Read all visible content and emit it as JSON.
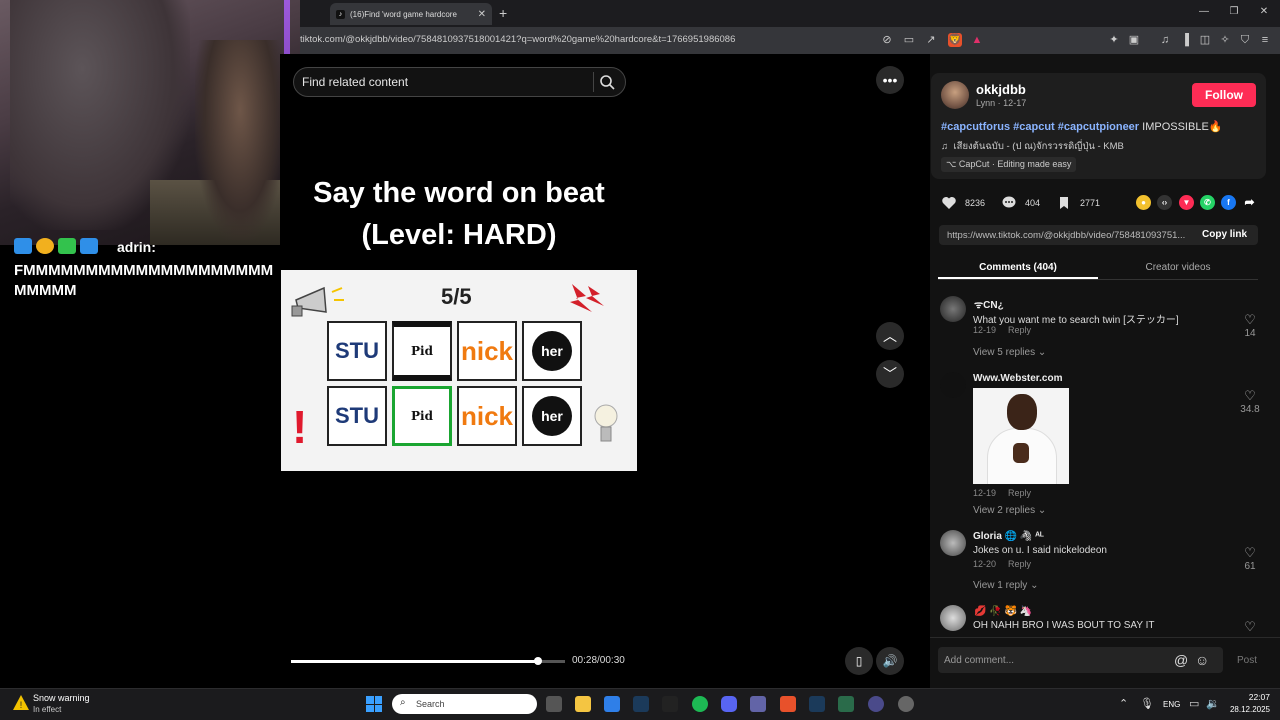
{
  "browser": {
    "tab_title": "(16)Find 'word game hardcore",
    "url": "tiktok.com/@okkjdbb/video/7584810937518001421?q=word%20game%20hardcore&t=1766951986086"
  },
  "chat": {
    "username": "adrin:",
    "message": "FMMMMMMMMMMMMMMMMMMMMMMMMM"
  },
  "video": {
    "search_placeholder": "Find related content",
    "headline_line1": "Say the word on beat",
    "headline_line2": "(Level: HARD)",
    "score": "5/5",
    "row1": [
      "STU",
      "Pid",
      "nick",
      "her"
    ],
    "row2": [
      "STU",
      "Pid",
      "nick",
      "her"
    ],
    "time": "00:28/00:30",
    "progress": 0.9
  },
  "post": {
    "username": "okkjdbb",
    "subline": "Lynn · 12-17",
    "follow_label": "Follow",
    "hashtags": [
      "#capcutforus",
      "#capcut",
      "#capcutpioneer"
    ],
    "caption_rest": " IMPOSSIBLE🔥",
    "music": "เสียงต้นฉบับ - (ป ณ)จักรวรรดิญี่ปุ่น - KMB",
    "capcut": "CapCut · Editing made easy",
    "likes": "8236",
    "comments": "404",
    "saves": "2771",
    "link": "https://www.tiktok.com/@okkjdbb/video/758481093751...",
    "copy_label": "Copy link",
    "tab_comments": "Comments (404)",
    "tab_creator": "Creator videos"
  },
  "comments": [
    {
      "name": "ᯤCN¿",
      "text": "What you want me to search twin [ステッカー]",
      "date": "12-19",
      "reply": "Reply",
      "replies": "View 5 replies",
      "likes": "14"
    },
    {
      "name": "Www.Webster.com",
      "text": "",
      "date": "12-19",
      "reply": "Reply",
      "replies": "View 2 replies",
      "likes": "34.8"
    },
    {
      "name": "Gloria 🌐 🦓 ᴬᴸ",
      "text": "Jokes on u. I said nickelodeon",
      "date": "12-20",
      "reply": "Reply",
      "replies": "View 1 reply",
      "likes": "61"
    },
    {
      "name": "💋 🥀 🐯 🦄",
      "text": "OH NAHH BRO I WAS BOUT TO SAY IT",
      "date": "",
      "reply": "",
      "replies": "",
      "likes": ""
    }
  ],
  "comment_input": {
    "placeholder": "Add comment...",
    "post_label": "Post"
  },
  "taskbar": {
    "weather_title": "Snow warning",
    "weather_sub": "In effect",
    "search_placeholder": "Search",
    "lang": "ENG",
    "time": "22:07",
    "date": "28.12.2025"
  },
  "colors": {
    "follow": "#fe2c55",
    "hashtag": "#8ab4ff",
    "active_cell": "#1aa531",
    "nick": "#f07a10"
  }
}
